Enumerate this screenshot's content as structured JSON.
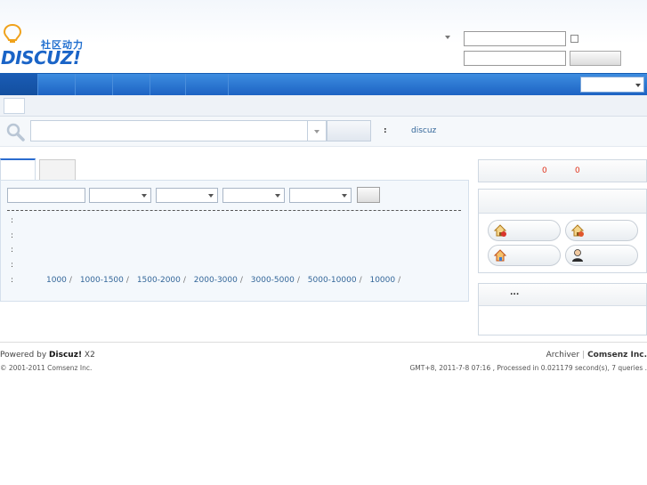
{
  "header": {
    "logo_cn": "社区动力",
    "logo_text": "DISCUZ!"
  },
  "search": {
    "hot_colon": ":",
    "hot_keyword": "discuz"
  },
  "filter": {
    "row_colons": [
      ":",
      ":",
      ":",
      ":",
      ":"
    ],
    "price_ranges": [
      "1000",
      "1000-1500",
      "1500-2000",
      "2000-3000",
      "3000-5000",
      "5000-10000",
      "10000"
    ],
    "separator": "/"
  },
  "sidebar": {
    "stat_values": [
      "0",
      "0"
    ],
    "links_ellipsis": "..."
  },
  "footer": {
    "powered_prefix": "Powered by",
    "brand": "Discuz!",
    "version": "X2",
    "copyright": "© 2001-2011 Comsenz Inc.",
    "archiver": "Archiver",
    "company": "Comsenz Inc.",
    "pipe": "|",
    "timing": "GMT+8, 2011-7-8 07:16 , Processed in 0.021179 second(s), 7 queries ."
  },
  "colors": {
    "nav_top": "#3d8de0",
    "nav_bottom": "#1d63c3",
    "link": "#336699",
    "stat": "#e0321c"
  },
  "icons": [
    "lightbulb-logo-icon",
    "search-magnifier-icon",
    "house-add-icon",
    "house-edit-icon",
    "house-home-icon",
    "user-person-icon"
  ]
}
